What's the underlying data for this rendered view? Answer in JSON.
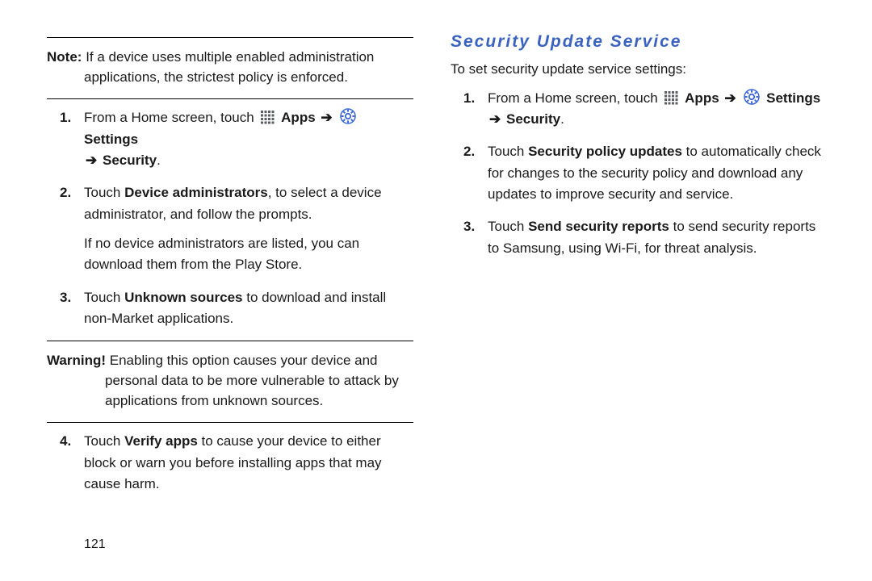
{
  "page_number": "121",
  "left": {
    "note": {
      "label": "Note:",
      "text": "If a device uses multiple enabled administration applications, the strictest policy is enforced."
    },
    "step1": {
      "prefix": "From a Home screen, touch ",
      "apps": "Apps",
      "settings": "Settings",
      "security": "Security"
    },
    "step2": {
      "pre": "Touch ",
      "bold": "Device administrators",
      "post": ", to select a device administrator, and follow the prompts.",
      "sub": "If no device administrators are listed, you can download them from the Play Store."
    },
    "step3": {
      "pre": "Touch ",
      "bold": "Unknown sources",
      "post": " to download and install non-Market applications."
    },
    "warning": {
      "label": "Warning!",
      "text": "Enabling this option causes your device and personal data to be more vulnerable to attack by applications from unknown sources."
    },
    "step4": {
      "pre": "Touch ",
      "bold": "Verify apps",
      "post": " to cause your device to either block or warn you before installing apps that may cause harm."
    }
  },
  "right": {
    "title": "Security Update Service",
    "intro": "To set security update service settings:",
    "step1": {
      "prefix": "From a Home screen, touch ",
      "apps": "Apps",
      "settings": "Settings",
      "security": "Security"
    },
    "step2": {
      "pre": "Touch ",
      "bold": "Security policy updates",
      "post": " to automatically check for changes to the security policy and download any updates to improve security and service."
    },
    "step3": {
      "pre": "Touch ",
      "bold": "Send security reports",
      "post": " to send security reports to Samsung, using Wi-Fi, for threat analysis."
    }
  },
  "glyphs": {
    "arrow": "➔",
    "dot": "."
  }
}
